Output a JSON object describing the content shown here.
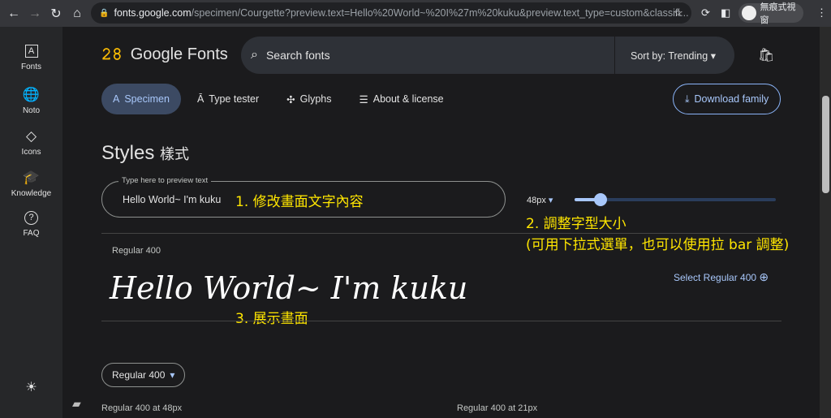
{
  "browser": {
    "url_host": "fonts.google.com",
    "url_path": "/specimen/Courgette?preview.text=Hello%20World~%20I%27m%20kuku&preview.text_type=custom&classifi...",
    "profile_label": "無痕式視窗"
  },
  "sidebar": {
    "items": [
      {
        "label": "Fonts",
        "icon": "A"
      },
      {
        "label": "Noto",
        "icon": "🌐"
      },
      {
        "label": "Icons",
        "icon": "◇"
      },
      {
        "label": "Knowledge",
        "icon": "🎓"
      },
      {
        "label": "FAQ",
        "icon": "?"
      }
    ],
    "theme_icon": "☀"
  },
  "header": {
    "logo": "Google Fonts",
    "search_placeholder": "Search fonts",
    "sort": "Sort by: Trending"
  },
  "tabs": [
    {
      "label": "Specimen",
      "icon": "A"
    },
    {
      "label": "Type tester",
      "icon": "Ā"
    },
    {
      "label": "Glyphs",
      "icon": "✣"
    },
    {
      "label": "About & license",
      "icon": "☰"
    }
  ],
  "download": "Download family",
  "styles": {
    "title": "Styles",
    "title_cjk": "樣式",
    "preview_label": "Type here to preview text",
    "preview_value": "Hello World~ I'm kuku",
    "size": "48px",
    "slider_fraction": 0.13
  },
  "annotations": {
    "a1": "1. 修改畫面文字內容",
    "a2": "2. 調整字型大小",
    "a2b": "(可用下拉式選單，也可以使用拉 bar 調整)",
    "a3": "3. 展示畫面"
  },
  "specimen": {
    "style_label": "Regular 400",
    "sample": "Hello World~ I'm kuku",
    "select": "Select Regular 400"
  },
  "bottom": {
    "dropdown": "Regular 400",
    "cap1": "Regular 400 at 48px",
    "cap2": "Regular 400 at 21px"
  }
}
